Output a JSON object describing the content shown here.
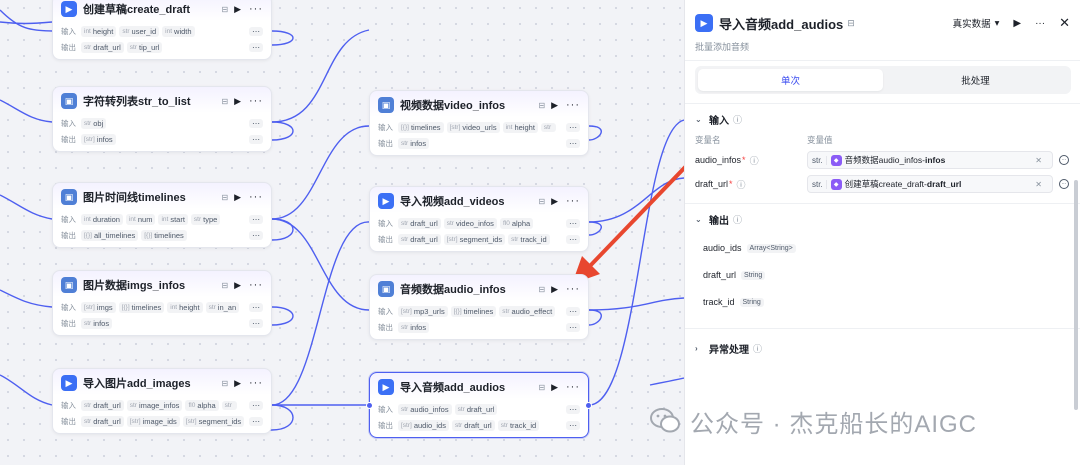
{
  "nodes": [
    {
      "id": "n1",
      "title": "创建草稿create_draft",
      "icon": "plugin",
      "inputs": [
        {
          "type": "int",
          "name": "height"
        },
        {
          "type": "str",
          "name": "user_id"
        },
        {
          "type": "int",
          "name": "width"
        }
      ],
      "outputs": [
        {
          "type": "str",
          "name": "draft_url"
        },
        {
          "type": "str",
          "name": "tip_url"
        }
      ]
    },
    {
      "id": "n2",
      "title": "字符转列表str_to_list",
      "icon": "code",
      "inputs": [
        {
          "type": "str",
          "name": "obj"
        }
      ],
      "outputs": [
        {
          "type": "[str]",
          "name": "infos"
        }
      ]
    },
    {
      "id": "n3",
      "title": "图片时间线timelines",
      "icon": "code",
      "inputs": [
        {
          "type": "int",
          "name": "duration"
        },
        {
          "type": "int",
          "name": "num"
        },
        {
          "type": "int",
          "name": "start"
        },
        {
          "type": "str",
          "name": "type"
        }
      ],
      "outputs": [
        {
          "type": "[{}]",
          "name": "all_timelines"
        },
        {
          "type": "[{}]",
          "name": "timelines"
        }
      ]
    },
    {
      "id": "n4",
      "title": "图片数据imgs_infos",
      "icon": "code",
      "inputs": [
        {
          "type": "[str]",
          "name": "imgs"
        },
        {
          "type": "[{}]",
          "name": "timelines"
        },
        {
          "type": "int",
          "name": "height"
        },
        {
          "type": "str",
          "name": "in_an"
        }
      ],
      "outputs": [
        {
          "type": "str",
          "name": "infos"
        }
      ]
    },
    {
      "id": "n5",
      "title": "导入图片add_images",
      "icon": "plugin",
      "inputs": [
        {
          "type": "str",
          "name": "draft_url"
        },
        {
          "type": "str",
          "name": "image_infos"
        },
        {
          "type": "fl0",
          "name": "alpha"
        },
        {
          "type": "str",
          "name": ""
        }
      ],
      "outputs": [
        {
          "type": "str",
          "name": "draft_url"
        },
        {
          "type": "[str]",
          "name": "image_ids"
        },
        {
          "type": "[str]",
          "name": "segment_ids"
        }
      ]
    },
    {
      "id": "n6",
      "title": "视频数据video_infos",
      "icon": "code",
      "inputs": [
        {
          "type": "[{}]",
          "name": "timelines"
        },
        {
          "type": "[str]",
          "name": "video_urls"
        },
        {
          "type": "int",
          "name": "height"
        },
        {
          "type": "str",
          "name": ""
        }
      ],
      "outputs": [
        {
          "type": "str",
          "name": "infos"
        }
      ]
    },
    {
      "id": "n7",
      "title": "导入视频add_videos",
      "icon": "plugin",
      "inputs": [
        {
          "type": "str",
          "name": "draft_url"
        },
        {
          "type": "str",
          "name": "video_infos"
        },
        {
          "type": "fl0",
          "name": "alpha"
        }
      ],
      "outputs": [
        {
          "type": "str",
          "name": "draft_url"
        },
        {
          "type": "[str]",
          "name": "segment_ids"
        },
        {
          "type": "str",
          "name": "track_id"
        }
      ]
    },
    {
      "id": "n8",
      "title": "音频数据audio_infos",
      "icon": "code",
      "inputs": [
        {
          "type": "[str]",
          "name": "mp3_urls"
        },
        {
          "type": "[{}]",
          "name": "timelines"
        },
        {
          "type": "str",
          "name": "audio_effect"
        }
      ],
      "outputs": [
        {
          "type": "str",
          "name": "infos"
        }
      ]
    },
    {
      "id": "n9",
      "title": "导入音频add_audios",
      "icon": "plugin",
      "inputs": [
        {
          "type": "str",
          "name": "audio_infos"
        },
        {
          "type": "str",
          "name": "draft_url"
        }
      ],
      "outputs": [
        {
          "type": "[str]",
          "name": "audio_ids"
        },
        {
          "type": "str",
          "name": "draft_url"
        },
        {
          "type": "str",
          "name": "track_id"
        }
      ]
    }
  ],
  "node_labels": {
    "input": "输入",
    "output": "输出",
    "more": "···"
  },
  "panel": {
    "title": "导入音频add_audios",
    "description": "批量添加音频",
    "mode_label": "真实数据",
    "tabs": [
      "单次",
      "批处理"
    ],
    "input_section": "输入",
    "col_name": "变量名",
    "col_value": "变量值",
    "vars": [
      {
        "name": "audio_infos",
        "type": "str.",
        "ref_node": "音频数据audio_infos",
        "sep": " - ",
        "ref_field": "infos"
      },
      {
        "name": "draft_url",
        "type": "str.",
        "ref_node": "创建草稿create_draft",
        "sep": " - ",
        "ref_field": "draft_url"
      }
    ],
    "output_section": "输出",
    "outputs": [
      {
        "name": "audio_ids",
        "type": "Array<String>"
      },
      {
        "name": "draft_url",
        "type": "String"
      },
      {
        "name": "track_id",
        "type": "String"
      }
    ],
    "exception_section": "异常处理"
  },
  "watermark": "公众号 · 杰克船长的AIGC",
  "colors": {
    "accent": "#4e5ff0",
    "arrow": "#e8472f",
    "edge": "#4e5ff0"
  }
}
